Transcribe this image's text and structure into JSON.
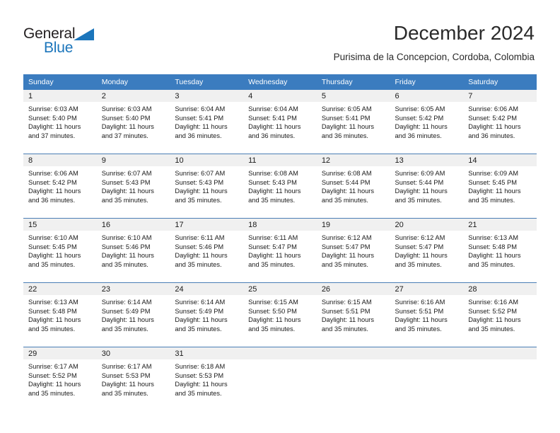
{
  "branding": {
    "name_part1": "General",
    "name_part2": "Blue",
    "triangle_color": "#1b75bb"
  },
  "header": {
    "title": "December 2024",
    "subtitle": "Purisima de la Concepcion, Cordoba, Colombia"
  },
  "theme": {
    "header_row_bg": "#3b7cbf",
    "daynum_strip_bg": "#f0f0f0",
    "row_divider": "#4a7eb5",
    "text": "#1a1a1a"
  },
  "weekdays": [
    "Sunday",
    "Monday",
    "Tuesday",
    "Wednesday",
    "Thursday",
    "Friday",
    "Saturday"
  ],
  "weeks": [
    {
      "days": [
        {
          "num": "1",
          "sunrise": "Sunrise: 6:03 AM",
          "sunset": "Sunset: 5:40 PM",
          "daylight_1": "Daylight: 11 hours",
          "daylight_2": "and 37 minutes."
        },
        {
          "num": "2",
          "sunrise": "Sunrise: 6:03 AM",
          "sunset": "Sunset: 5:40 PM",
          "daylight_1": "Daylight: 11 hours",
          "daylight_2": "and 37 minutes."
        },
        {
          "num": "3",
          "sunrise": "Sunrise: 6:04 AM",
          "sunset": "Sunset: 5:41 PM",
          "daylight_1": "Daylight: 11 hours",
          "daylight_2": "and 36 minutes."
        },
        {
          "num": "4",
          "sunrise": "Sunrise: 6:04 AM",
          "sunset": "Sunset: 5:41 PM",
          "daylight_1": "Daylight: 11 hours",
          "daylight_2": "and 36 minutes."
        },
        {
          "num": "5",
          "sunrise": "Sunrise: 6:05 AM",
          "sunset": "Sunset: 5:41 PM",
          "daylight_1": "Daylight: 11 hours",
          "daylight_2": "and 36 minutes."
        },
        {
          "num": "6",
          "sunrise": "Sunrise: 6:05 AM",
          "sunset": "Sunset: 5:42 PM",
          "daylight_1": "Daylight: 11 hours",
          "daylight_2": "and 36 minutes."
        },
        {
          "num": "7",
          "sunrise": "Sunrise: 6:06 AM",
          "sunset": "Sunset: 5:42 PM",
          "daylight_1": "Daylight: 11 hours",
          "daylight_2": "and 36 minutes."
        }
      ]
    },
    {
      "days": [
        {
          "num": "8",
          "sunrise": "Sunrise: 6:06 AM",
          "sunset": "Sunset: 5:42 PM",
          "daylight_1": "Daylight: 11 hours",
          "daylight_2": "and 36 minutes."
        },
        {
          "num": "9",
          "sunrise": "Sunrise: 6:07 AM",
          "sunset": "Sunset: 5:43 PM",
          "daylight_1": "Daylight: 11 hours",
          "daylight_2": "and 35 minutes."
        },
        {
          "num": "10",
          "sunrise": "Sunrise: 6:07 AM",
          "sunset": "Sunset: 5:43 PM",
          "daylight_1": "Daylight: 11 hours",
          "daylight_2": "and 35 minutes."
        },
        {
          "num": "11",
          "sunrise": "Sunrise: 6:08 AM",
          "sunset": "Sunset: 5:43 PM",
          "daylight_1": "Daylight: 11 hours",
          "daylight_2": "and 35 minutes."
        },
        {
          "num": "12",
          "sunrise": "Sunrise: 6:08 AM",
          "sunset": "Sunset: 5:44 PM",
          "daylight_1": "Daylight: 11 hours",
          "daylight_2": "and 35 minutes."
        },
        {
          "num": "13",
          "sunrise": "Sunrise: 6:09 AM",
          "sunset": "Sunset: 5:44 PM",
          "daylight_1": "Daylight: 11 hours",
          "daylight_2": "and 35 minutes."
        },
        {
          "num": "14",
          "sunrise": "Sunrise: 6:09 AM",
          "sunset": "Sunset: 5:45 PM",
          "daylight_1": "Daylight: 11 hours",
          "daylight_2": "and 35 minutes."
        }
      ]
    },
    {
      "days": [
        {
          "num": "15",
          "sunrise": "Sunrise: 6:10 AM",
          "sunset": "Sunset: 5:45 PM",
          "daylight_1": "Daylight: 11 hours",
          "daylight_2": "and 35 minutes."
        },
        {
          "num": "16",
          "sunrise": "Sunrise: 6:10 AM",
          "sunset": "Sunset: 5:46 PM",
          "daylight_1": "Daylight: 11 hours",
          "daylight_2": "and 35 minutes."
        },
        {
          "num": "17",
          "sunrise": "Sunrise: 6:11 AM",
          "sunset": "Sunset: 5:46 PM",
          "daylight_1": "Daylight: 11 hours",
          "daylight_2": "and 35 minutes."
        },
        {
          "num": "18",
          "sunrise": "Sunrise: 6:11 AM",
          "sunset": "Sunset: 5:47 PM",
          "daylight_1": "Daylight: 11 hours",
          "daylight_2": "and 35 minutes."
        },
        {
          "num": "19",
          "sunrise": "Sunrise: 6:12 AM",
          "sunset": "Sunset: 5:47 PM",
          "daylight_1": "Daylight: 11 hours",
          "daylight_2": "and 35 minutes."
        },
        {
          "num": "20",
          "sunrise": "Sunrise: 6:12 AM",
          "sunset": "Sunset: 5:47 PM",
          "daylight_1": "Daylight: 11 hours",
          "daylight_2": "and 35 minutes."
        },
        {
          "num": "21",
          "sunrise": "Sunrise: 6:13 AM",
          "sunset": "Sunset: 5:48 PM",
          "daylight_1": "Daylight: 11 hours",
          "daylight_2": "and 35 minutes."
        }
      ]
    },
    {
      "days": [
        {
          "num": "22",
          "sunrise": "Sunrise: 6:13 AM",
          "sunset": "Sunset: 5:48 PM",
          "daylight_1": "Daylight: 11 hours",
          "daylight_2": "and 35 minutes."
        },
        {
          "num": "23",
          "sunrise": "Sunrise: 6:14 AM",
          "sunset": "Sunset: 5:49 PM",
          "daylight_1": "Daylight: 11 hours",
          "daylight_2": "and 35 minutes."
        },
        {
          "num": "24",
          "sunrise": "Sunrise: 6:14 AM",
          "sunset": "Sunset: 5:49 PM",
          "daylight_1": "Daylight: 11 hours",
          "daylight_2": "and 35 minutes."
        },
        {
          "num": "25",
          "sunrise": "Sunrise: 6:15 AM",
          "sunset": "Sunset: 5:50 PM",
          "daylight_1": "Daylight: 11 hours",
          "daylight_2": "and 35 minutes."
        },
        {
          "num": "26",
          "sunrise": "Sunrise: 6:15 AM",
          "sunset": "Sunset: 5:51 PM",
          "daylight_1": "Daylight: 11 hours",
          "daylight_2": "and 35 minutes."
        },
        {
          "num": "27",
          "sunrise": "Sunrise: 6:16 AM",
          "sunset": "Sunset: 5:51 PM",
          "daylight_1": "Daylight: 11 hours",
          "daylight_2": "and 35 minutes."
        },
        {
          "num": "28",
          "sunrise": "Sunrise: 6:16 AM",
          "sunset": "Sunset: 5:52 PM",
          "daylight_1": "Daylight: 11 hours",
          "daylight_2": "and 35 minutes."
        }
      ]
    },
    {
      "days": [
        {
          "num": "29",
          "sunrise": "Sunrise: 6:17 AM",
          "sunset": "Sunset: 5:52 PM",
          "daylight_1": "Daylight: 11 hours",
          "daylight_2": "and 35 minutes."
        },
        {
          "num": "30",
          "sunrise": "Sunrise: 6:17 AM",
          "sunset": "Sunset: 5:53 PM",
          "daylight_1": "Daylight: 11 hours",
          "daylight_2": "and 35 minutes."
        },
        {
          "num": "31",
          "sunrise": "Sunrise: 6:18 AM",
          "sunset": "Sunset: 5:53 PM",
          "daylight_1": "Daylight: 11 hours",
          "daylight_2": "and 35 minutes."
        },
        {
          "num": "",
          "sunrise": "",
          "sunset": "",
          "daylight_1": "",
          "daylight_2": ""
        },
        {
          "num": "",
          "sunrise": "",
          "sunset": "",
          "daylight_1": "",
          "daylight_2": ""
        },
        {
          "num": "",
          "sunrise": "",
          "sunset": "",
          "daylight_1": "",
          "daylight_2": ""
        },
        {
          "num": "",
          "sunrise": "",
          "sunset": "",
          "daylight_1": "",
          "daylight_2": ""
        }
      ]
    }
  ]
}
